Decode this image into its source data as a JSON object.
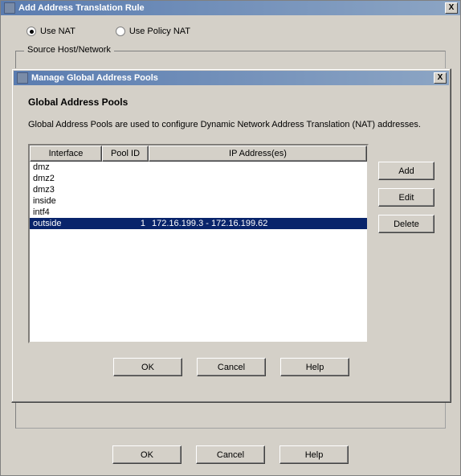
{
  "back": {
    "title": "Add Address Translation Rule",
    "close_symbol": "X",
    "radio_nat": "Use NAT",
    "radio_policy": "Use Policy NAT",
    "fieldset_label": "Source Host/Network",
    "buttons": {
      "ok": "OK",
      "cancel": "Cancel",
      "help": "Help"
    }
  },
  "front": {
    "title": "Manage Global Address Pools",
    "close_symbol": "X",
    "heading": "Global Address Pools",
    "description": "Global Address Pools are used to configure Dynamic Network Address Translation (NAT) addresses.",
    "columns": {
      "interface": "Interface",
      "pool_id": "Pool ID",
      "ip": "IP Address(es)"
    },
    "rows": [
      {
        "interface": "dmz",
        "pool_id": "",
        "ip": "",
        "selected": false
      },
      {
        "interface": "dmz2",
        "pool_id": "",
        "ip": "",
        "selected": false
      },
      {
        "interface": "dmz3",
        "pool_id": "",
        "ip": "",
        "selected": false
      },
      {
        "interface": "inside",
        "pool_id": "",
        "ip": "",
        "selected": false
      },
      {
        "interface": "intf4",
        "pool_id": "",
        "ip": "",
        "selected": false
      },
      {
        "interface": "outside",
        "pool_id": "1",
        "ip": "172.16.199.3 - 172.16.199.62",
        "selected": true
      }
    ],
    "side": {
      "add": "Add",
      "edit": "Edit",
      "delete": "Delete"
    },
    "buttons": {
      "ok": "OK",
      "cancel": "Cancel",
      "help": "Help"
    }
  }
}
